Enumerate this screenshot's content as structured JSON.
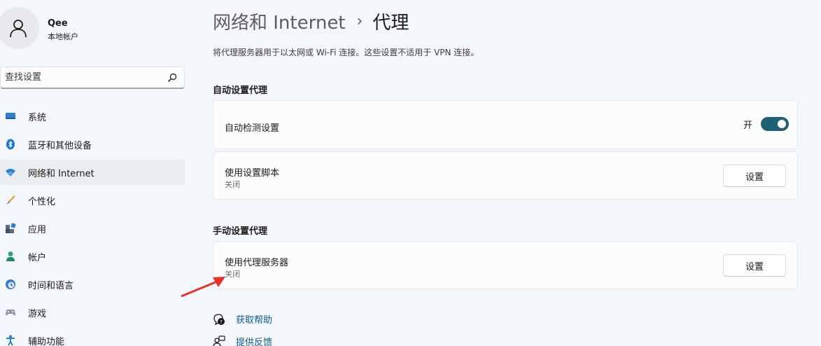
{
  "user": {
    "name": "Qee",
    "account_type": "本地帐户"
  },
  "search": {
    "placeholder": "查找设置"
  },
  "nav": {
    "items": [
      {
        "label": "系统",
        "icon": "monitor-icon"
      },
      {
        "label": "蓝牙和其他设备",
        "icon": "bluetooth-icon"
      },
      {
        "label": "网络和 Internet",
        "icon": "wifi-icon",
        "active": true
      },
      {
        "label": "个性化",
        "icon": "brush-icon"
      },
      {
        "label": "应用",
        "icon": "apps-icon"
      },
      {
        "label": "帐户",
        "icon": "person-icon"
      },
      {
        "label": "时间和语言",
        "icon": "globe-clock-icon"
      },
      {
        "label": "游戏",
        "icon": "gamepad-icon"
      },
      {
        "label": "辅助功能",
        "icon": "accessibility-icon"
      }
    ]
  },
  "header": {
    "parent": "网络和 Internet",
    "separator": "›",
    "current": "代理",
    "description": "将代理服务器用于以太网或 Wi-Fi 连接。这些设置不适用于 VPN 连接。"
  },
  "auto_section": {
    "title": "自动设置代理",
    "detect": {
      "title": "自动检测设置",
      "state_label": "开",
      "on": true
    },
    "script": {
      "title": "使用设置脚本",
      "status": "关闭",
      "button": "设置"
    }
  },
  "manual_section": {
    "title": "手动设置代理",
    "proxy": {
      "title": "使用代理服务器",
      "status": "关闭",
      "button": "设置"
    }
  },
  "links": [
    {
      "label": "获取帮助",
      "icon": "help-icon"
    },
    {
      "label": "提供反馈",
      "icon": "feedback-icon"
    }
  ],
  "colors": {
    "accent": "#1f6076",
    "link": "#0b5c8c",
    "annotation": "#e8312b"
  }
}
